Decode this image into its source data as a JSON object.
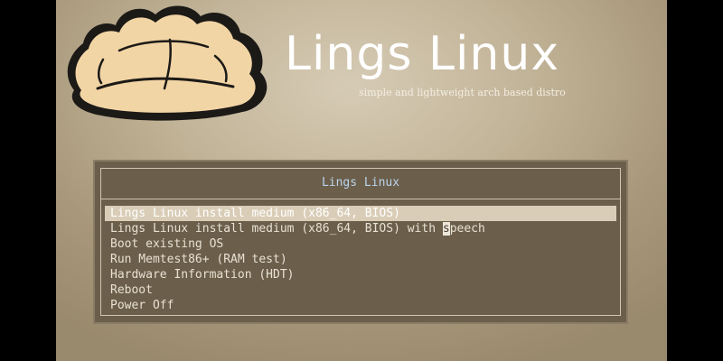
{
  "brand": {
    "title": "Lings Linux",
    "tagline": "simple and lightweight arch based distro"
  },
  "menu": {
    "title": "Lings Linux",
    "items": [
      {
        "label": "Lings Linux install medium (x86_64, BIOS)",
        "selected": true
      },
      {
        "label_before": "Lings Linux install medium (x86_64, BIOS) with ",
        "hotkey": "s",
        "label_after": "peech",
        "selected": false
      },
      {
        "label": "Boot existing OS",
        "selected": false
      },
      {
        "label": "Run Memtest86+ (RAM test)",
        "selected": false
      },
      {
        "label": "Hardware Information (HDT)",
        "selected": false
      },
      {
        "label": "Reboot",
        "selected": false
      },
      {
        "label": "Power Off",
        "selected": false
      }
    ]
  },
  "colors": {
    "background": "#b0a083",
    "menu_background": "#6b5e4a",
    "menu_title": "#b9d4ec",
    "selection": "#d9cdb7",
    "logo_fill": "#f2d5a5",
    "logo_outline": "#1a1a1a"
  },
  "icons": {
    "logo": "dumpling-logo-icon"
  }
}
